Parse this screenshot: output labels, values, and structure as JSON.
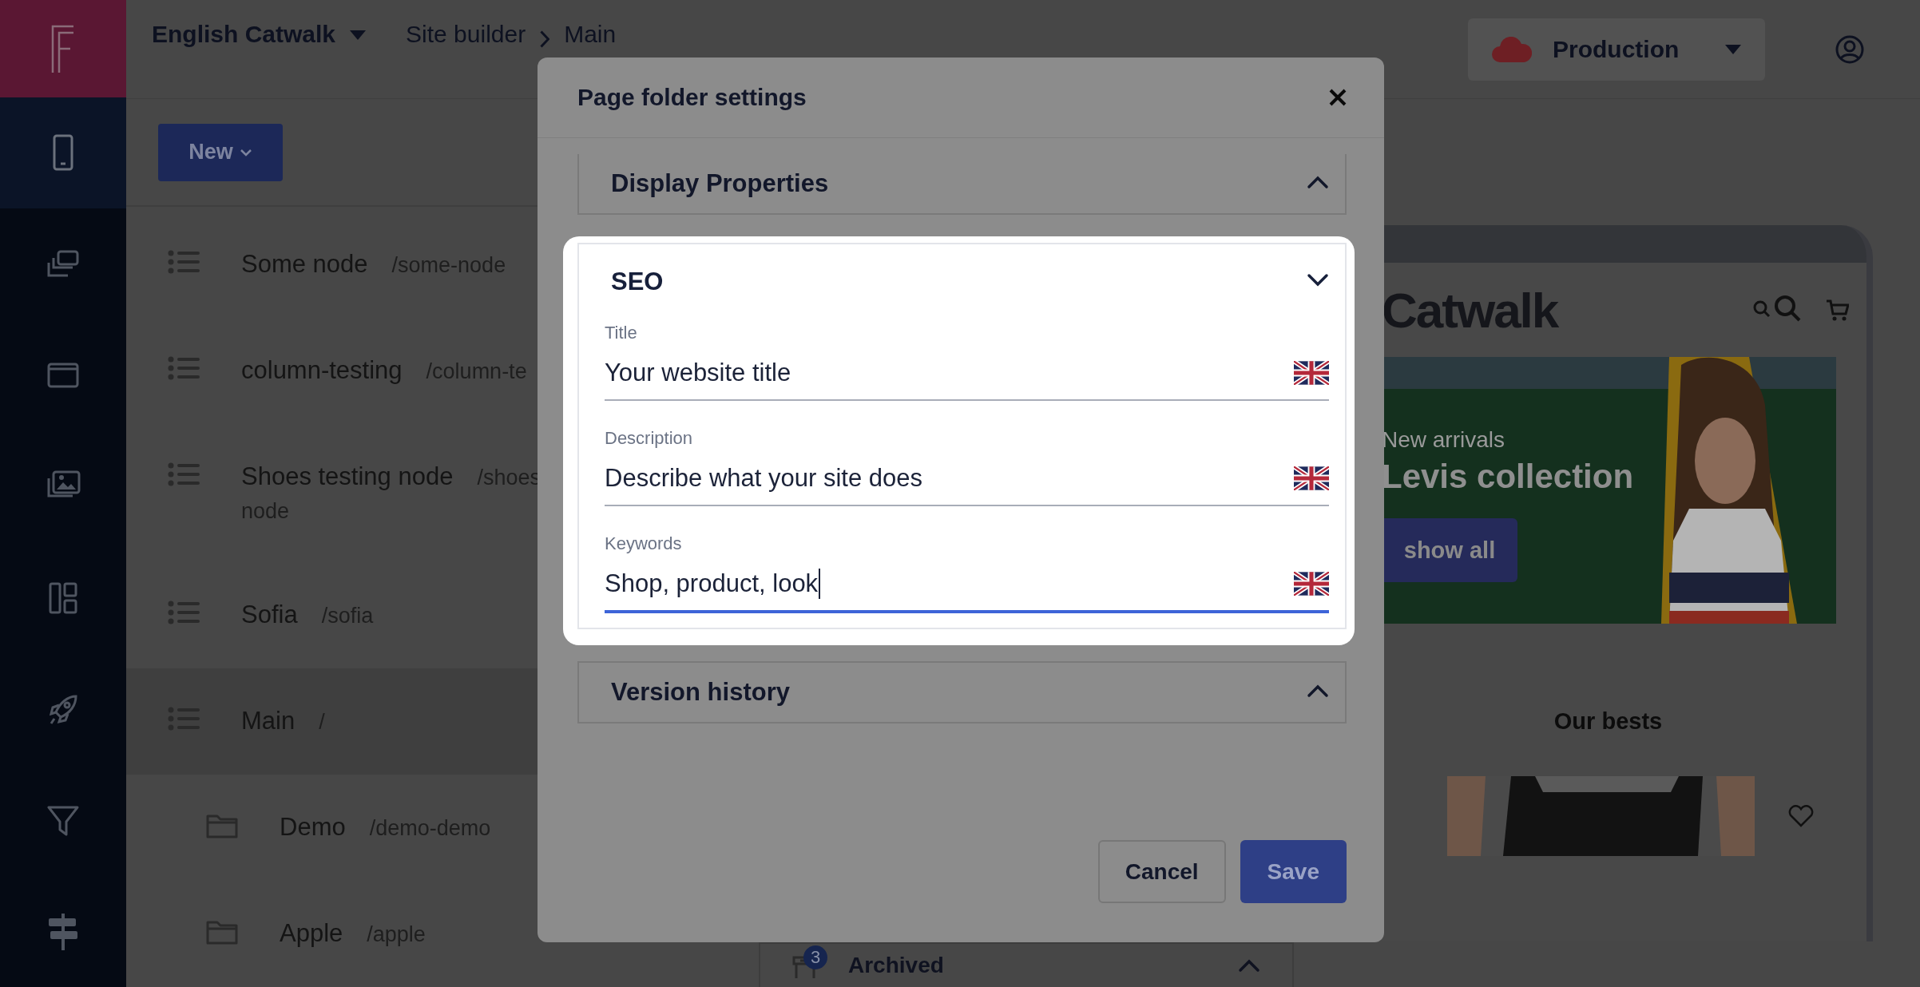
{
  "sidebar": {
    "items": [
      {
        "selected": true
      },
      {
        "selected": false
      },
      {
        "selected": false
      },
      {
        "selected": false
      },
      {
        "selected": false
      },
      {
        "selected": false
      },
      {
        "selected": false
      },
      {
        "selected": false
      }
    ]
  },
  "top_bar": {
    "project": "English Catwalk",
    "breadcrumb": [
      "Site builder",
      "Main"
    ],
    "environment": "Production"
  },
  "toolbar": {
    "new_button": "New"
  },
  "tree": [
    {
      "kind": "page",
      "name": "Some node",
      "path": "/some-node",
      "selected": false
    },
    {
      "kind": "page",
      "name": "column-testing",
      "path": "/column-te",
      "selected": false
    },
    {
      "kind": "page",
      "name": "Shoes testing node",
      "path": "/shoes",
      "path_continued": "node",
      "selected": false
    },
    {
      "kind": "page",
      "name": "Sofia",
      "path": "/sofia",
      "selected": false
    },
    {
      "kind": "page",
      "name": "Main",
      "path": "/",
      "selected": true,
      "children": [
        {
          "kind": "folder",
          "name": "Demo",
          "path": "/demo-demo"
        },
        {
          "kind": "folder",
          "name": "Apple",
          "path": "/apple"
        }
      ]
    }
  ],
  "archived": {
    "title": "Archived",
    "count": "3"
  },
  "preview": {
    "logo": "Catwalk",
    "banner": {
      "eyebrow": "New arrivals",
      "headline": "Levis collection",
      "button": "show all"
    },
    "section_title": "Our bests"
  },
  "modal": {
    "title": "Page folder settings",
    "sections": [
      {
        "title": "Display Properties",
        "expanded": false,
        "highlighted": false
      },
      {
        "title": "SEO",
        "expanded": true,
        "highlighted": true,
        "fields": [
          {
            "label": "Title",
            "value": "Your website title",
            "focused": false
          },
          {
            "label": "Description",
            "value": "Describe what your site does",
            "focused": false
          },
          {
            "label": "Keywords",
            "value": "Shop, product, look",
            "focused": true
          }
        ]
      },
      {
        "title": "Version history",
        "expanded": false,
        "highlighted": false
      }
    ],
    "buttons": [
      {
        "kind": "secondary",
        "label": "Cancel"
      },
      {
        "kind": "primary",
        "label": "Save"
      }
    ]
  }
}
